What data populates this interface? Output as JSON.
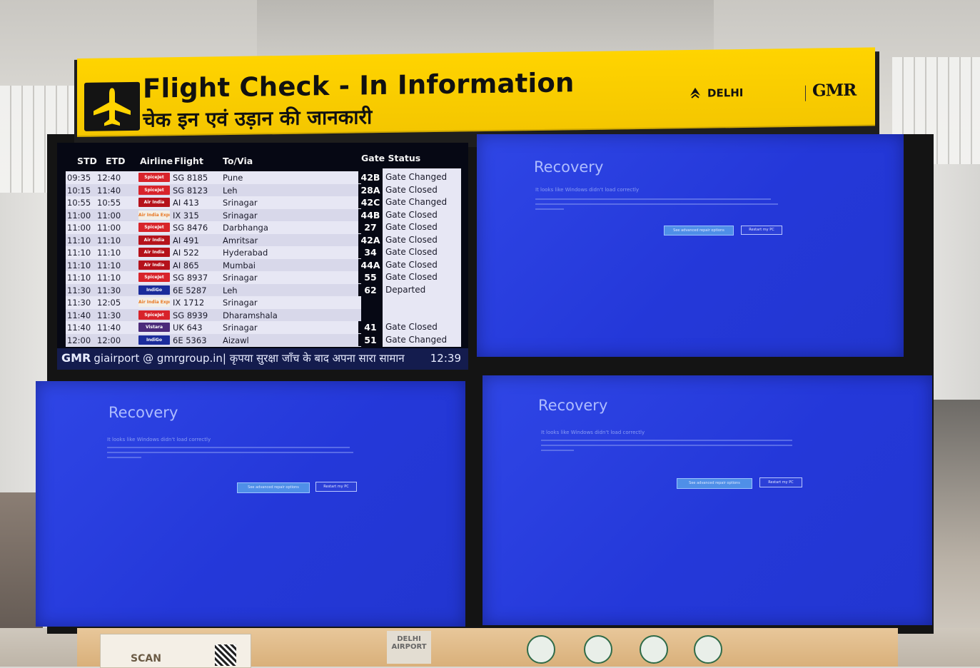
{
  "sign": {
    "title": "Flight Check - In Information",
    "title_hindi": "चेक इन एवं उड़ान की जानकारी",
    "airport_name": "DELHI",
    "operator": "GMR",
    "plane_icon": "airplane-icon"
  },
  "board": {
    "headers": {
      "std": "STD",
      "etd": "ETD",
      "airline": "Airline",
      "flight": "Flight",
      "to_via": "To/Via",
      "gate_status": "Gate Status"
    },
    "flights": [
      {
        "std": "09:35",
        "etd": "12:40",
        "airline": "SpiceJet",
        "flight": "SG 8185",
        "to": "Pune",
        "gate": "42B",
        "status": "Gate Changed"
      },
      {
        "std": "10:15",
        "etd": "11:40",
        "airline": "SpiceJet",
        "flight": "SG 8123",
        "to": "Leh",
        "gate": "28A",
        "status": "Gate Closed"
      },
      {
        "std": "10:55",
        "etd": "10:55",
        "airline": "Air India",
        "flight": "AI 413",
        "to": "Srinagar",
        "gate": "42C",
        "status": "Gate Changed"
      },
      {
        "std": "11:00",
        "etd": "11:00",
        "airline": "Air India Express",
        "flight": "IX 315",
        "to": "Srinagar",
        "gate": "44B",
        "status": "Gate Closed"
      },
      {
        "std": "11:00",
        "etd": "11:00",
        "airline": "SpiceJet",
        "flight": "SG 8476",
        "to": "Darbhanga",
        "gate": "27",
        "status": "Gate Closed"
      },
      {
        "std": "11:10",
        "etd": "11:10",
        "airline": "Air India",
        "flight": "AI 491",
        "to": "Amritsar",
        "gate": "42A",
        "status": "Gate Closed"
      },
      {
        "std": "11:10",
        "etd": "11:10",
        "airline": "Air India",
        "flight": "AI 522",
        "to": "Hyderabad",
        "gate": "34",
        "status": "Gate Closed"
      },
      {
        "std": "11:10",
        "etd": "11:10",
        "airline": "Air India",
        "flight": "AI 865",
        "to": "Mumbai",
        "gate": "44A",
        "status": "Gate Closed"
      },
      {
        "std": "11:10",
        "etd": "11:10",
        "airline": "SpiceJet",
        "flight": "SG 8937",
        "to": "Srinagar",
        "gate": "55",
        "status": "Gate Closed"
      },
      {
        "std": "11:30",
        "etd": "11:30",
        "airline": "IndiGo",
        "flight": "6E 5287",
        "to": "Leh",
        "gate": "62",
        "status": "Departed"
      },
      {
        "std": "11:30",
        "etd": "12:05",
        "airline": "Air India Express",
        "flight": "IX 1712",
        "to": "Srinagar",
        "gate": "",
        "status": ""
      },
      {
        "std": "11:40",
        "etd": "11:30",
        "airline": "SpiceJet",
        "flight": "SG 8939",
        "to": "Dharamshala",
        "gate": "",
        "status": ""
      },
      {
        "std": "11:40",
        "etd": "11:40",
        "airline": "Vistara",
        "flight": "UK 643",
        "to": "Srinagar",
        "gate": "41",
        "status": "Gate Closed"
      },
      {
        "std": "12:00",
        "etd": "12:00",
        "airline": "IndiGo",
        "flight": "6E 5363",
        "to": "Aizawl",
        "gate": "51",
        "status": "Gate Changed"
      }
    ],
    "ticker": {
      "brand": "GMR",
      "text": "giairport @ gmrgroup.in| कृपया सुरक्षा जाँच के बाद अपना सारा सामान",
      "time": "12:39"
    }
  },
  "recovery_screens": [
    {
      "title": "Recovery",
      "subtitle": "It looks like Windows didn't load correctly",
      "button_primary": "See advanced repair options",
      "button_secondary": "Restart my PC"
    },
    {
      "title": "Recovery",
      "subtitle": "It looks like Windows didn't load correctly",
      "button_primary": "See advanced repair options",
      "button_secondary": "Restart my PC"
    },
    {
      "title": "Recovery",
      "subtitle": "It looks like Windows didn't load correctly",
      "button_primary": "See advanced repair options",
      "button_secondary": "Restart my PC"
    }
  ],
  "colors": {
    "sign_yellow": "#ffd400",
    "board_bg": "#060814",
    "recovery_blue": "#2a3fe0",
    "spicejet_red": "#d8232a",
    "airindia_red": "#b5121b",
    "indigo_blue": "#1b2c9b",
    "vistara_purple": "#4b2a7a",
    "ix_orange": "#e87722"
  },
  "signage": {
    "scan_label": "SCAN",
    "delhi_airport_label": "DELHI AIRPORT"
  }
}
